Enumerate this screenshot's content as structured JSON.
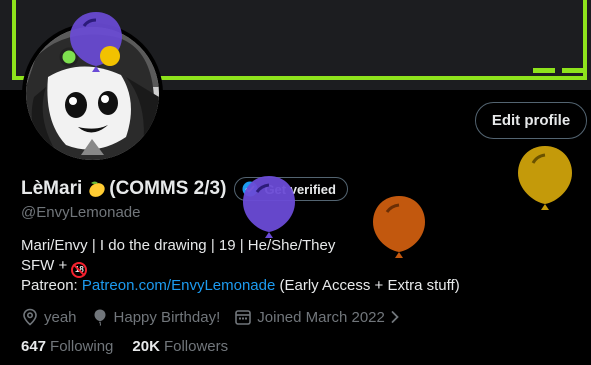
{
  "profile": {
    "display_name": "LèMari",
    "name_suffix": "(COMMS 2/3)",
    "handle": "@EnvyLemonade",
    "bio": {
      "line1": "Mari/Envy | I do the drawing | 19 | He/She/They",
      "line2_prefix": "SFW +",
      "age_badge": "18",
      "line3_prefix": "Patreon:",
      "link_text": "Patreon.com/EnvyLemonade",
      "line3_suffix": "(Early Access + Extra stuff)"
    },
    "meta": {
      "location": "yeah",
      "birthday": "Happy Birthday!",
      "joined": "Joined March 2022"
    },
    "following_count": "647",
    "following_label": "Following",
    "followers_count": "20K",
    "followers_label": "Followers"
  },
  "buttons": {
    "edit_profile": "Edit profile",
    "get_verified": "Get verified"
  },
  "colors": {
    "background": "#000000",
    "accent_link": "#1d9bf0",
    "banner_frame": "#8ee31c",
    "muted_text": "#71767b",
    "balloon_purple": "#6a4bd6",
    "balloon_orange": "#c2580e",
    "balloon_gold": "#c49a0a"
  },
  "icons": {
    "lemon": "lemon-emoji-icon",
    "verified": "verified-badge-icon",
    "location": "location-pin-icon",
    "birthday": "balloon-icon",
    "joined": "calendar-icon",
    "chevron": "chevron-right-icon"
  }
}
